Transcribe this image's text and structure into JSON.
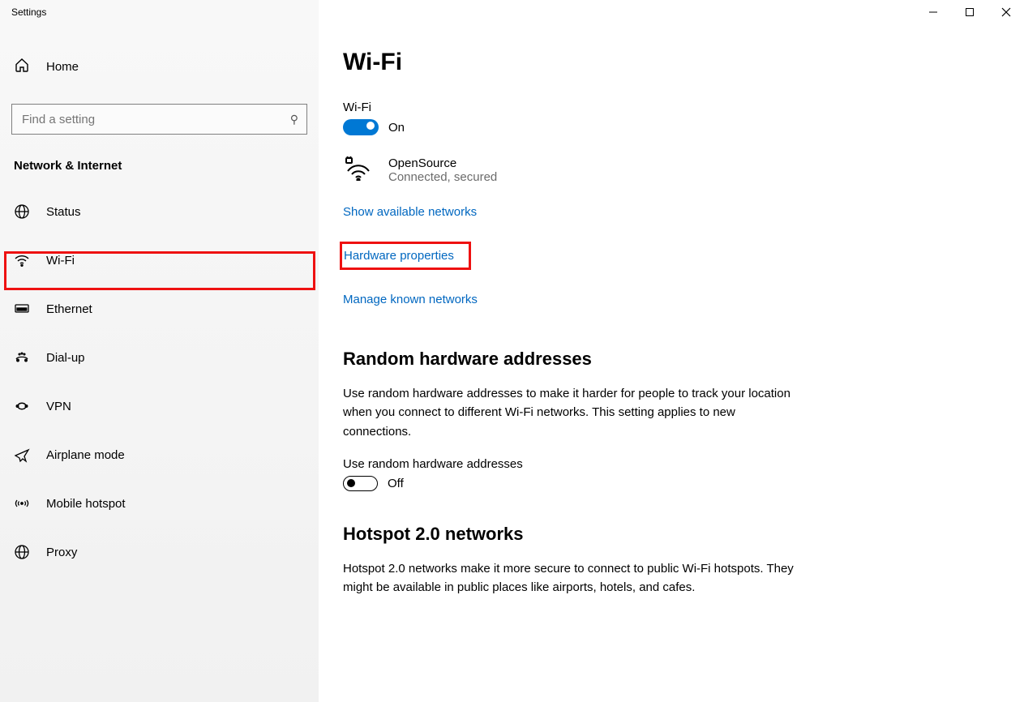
{
  "window": {
    "title": "Settings"
  },
  "sidebar": {
    "home_label": "Home",
    "search_placeholder": "Find a setting",
    "section_title": "Network & Internet",
    "items": [
      {
        "icon": "status",
        "label": "Status"
      },
      {
        "icon": "wifi",
        "label": "Wi-Fi"
      },
      {
        "icon": "ethernet",
        "label": "Ethernet"
      },
      {
        "icon": "dialup",
        "label": "Dial-up"
      },
      {
        "icon": "vpn",
        "label": "VPN"
      },
      {
        "icon": "airplane",
        "label": "Airplane mode"
      },
      {
        "icon": "hotspot",
        "label": "Mobile hotspot"
      },
      {
        "icon": "proxy",
        "label": "Proxy"
      }
    ]
  },
  "main": {
    "page_title": "Wi-Fi",
    "wifi_section_label": "Wi-Fi",
    "wifi_toggle": {
      "on": true,
      "label": "On"
    },
    "network": {
      "name": "OpenSource",
      "status": "Connected, secured"
    },
    "links": {
      "show_available": "Show available networks",
      "hardware_props": "Hardware properties",
      "manage_known": "Manage known networks"
    },
    "random_section": {
      "heading": "Random hardware addresses",
      "description": "Use random hardware addresses to make it harder for people to track your location when you connect to different Wi-Fi networks. This setting applies to new connections.",
      "toggle_caption": "Use random hardware addresses",
      "toggle": {
        "on": false,
        "label": "Off"
      }
    },
    "hotspot_section": {
      "heading": "Hotspot 2.0 networks",
      "description": "Hotspot 2.0 networks make it more secure to connect to public Wi-Fi hotspots. They might be available in public places like airports, hotels, and cafes."
    }
  }
}
